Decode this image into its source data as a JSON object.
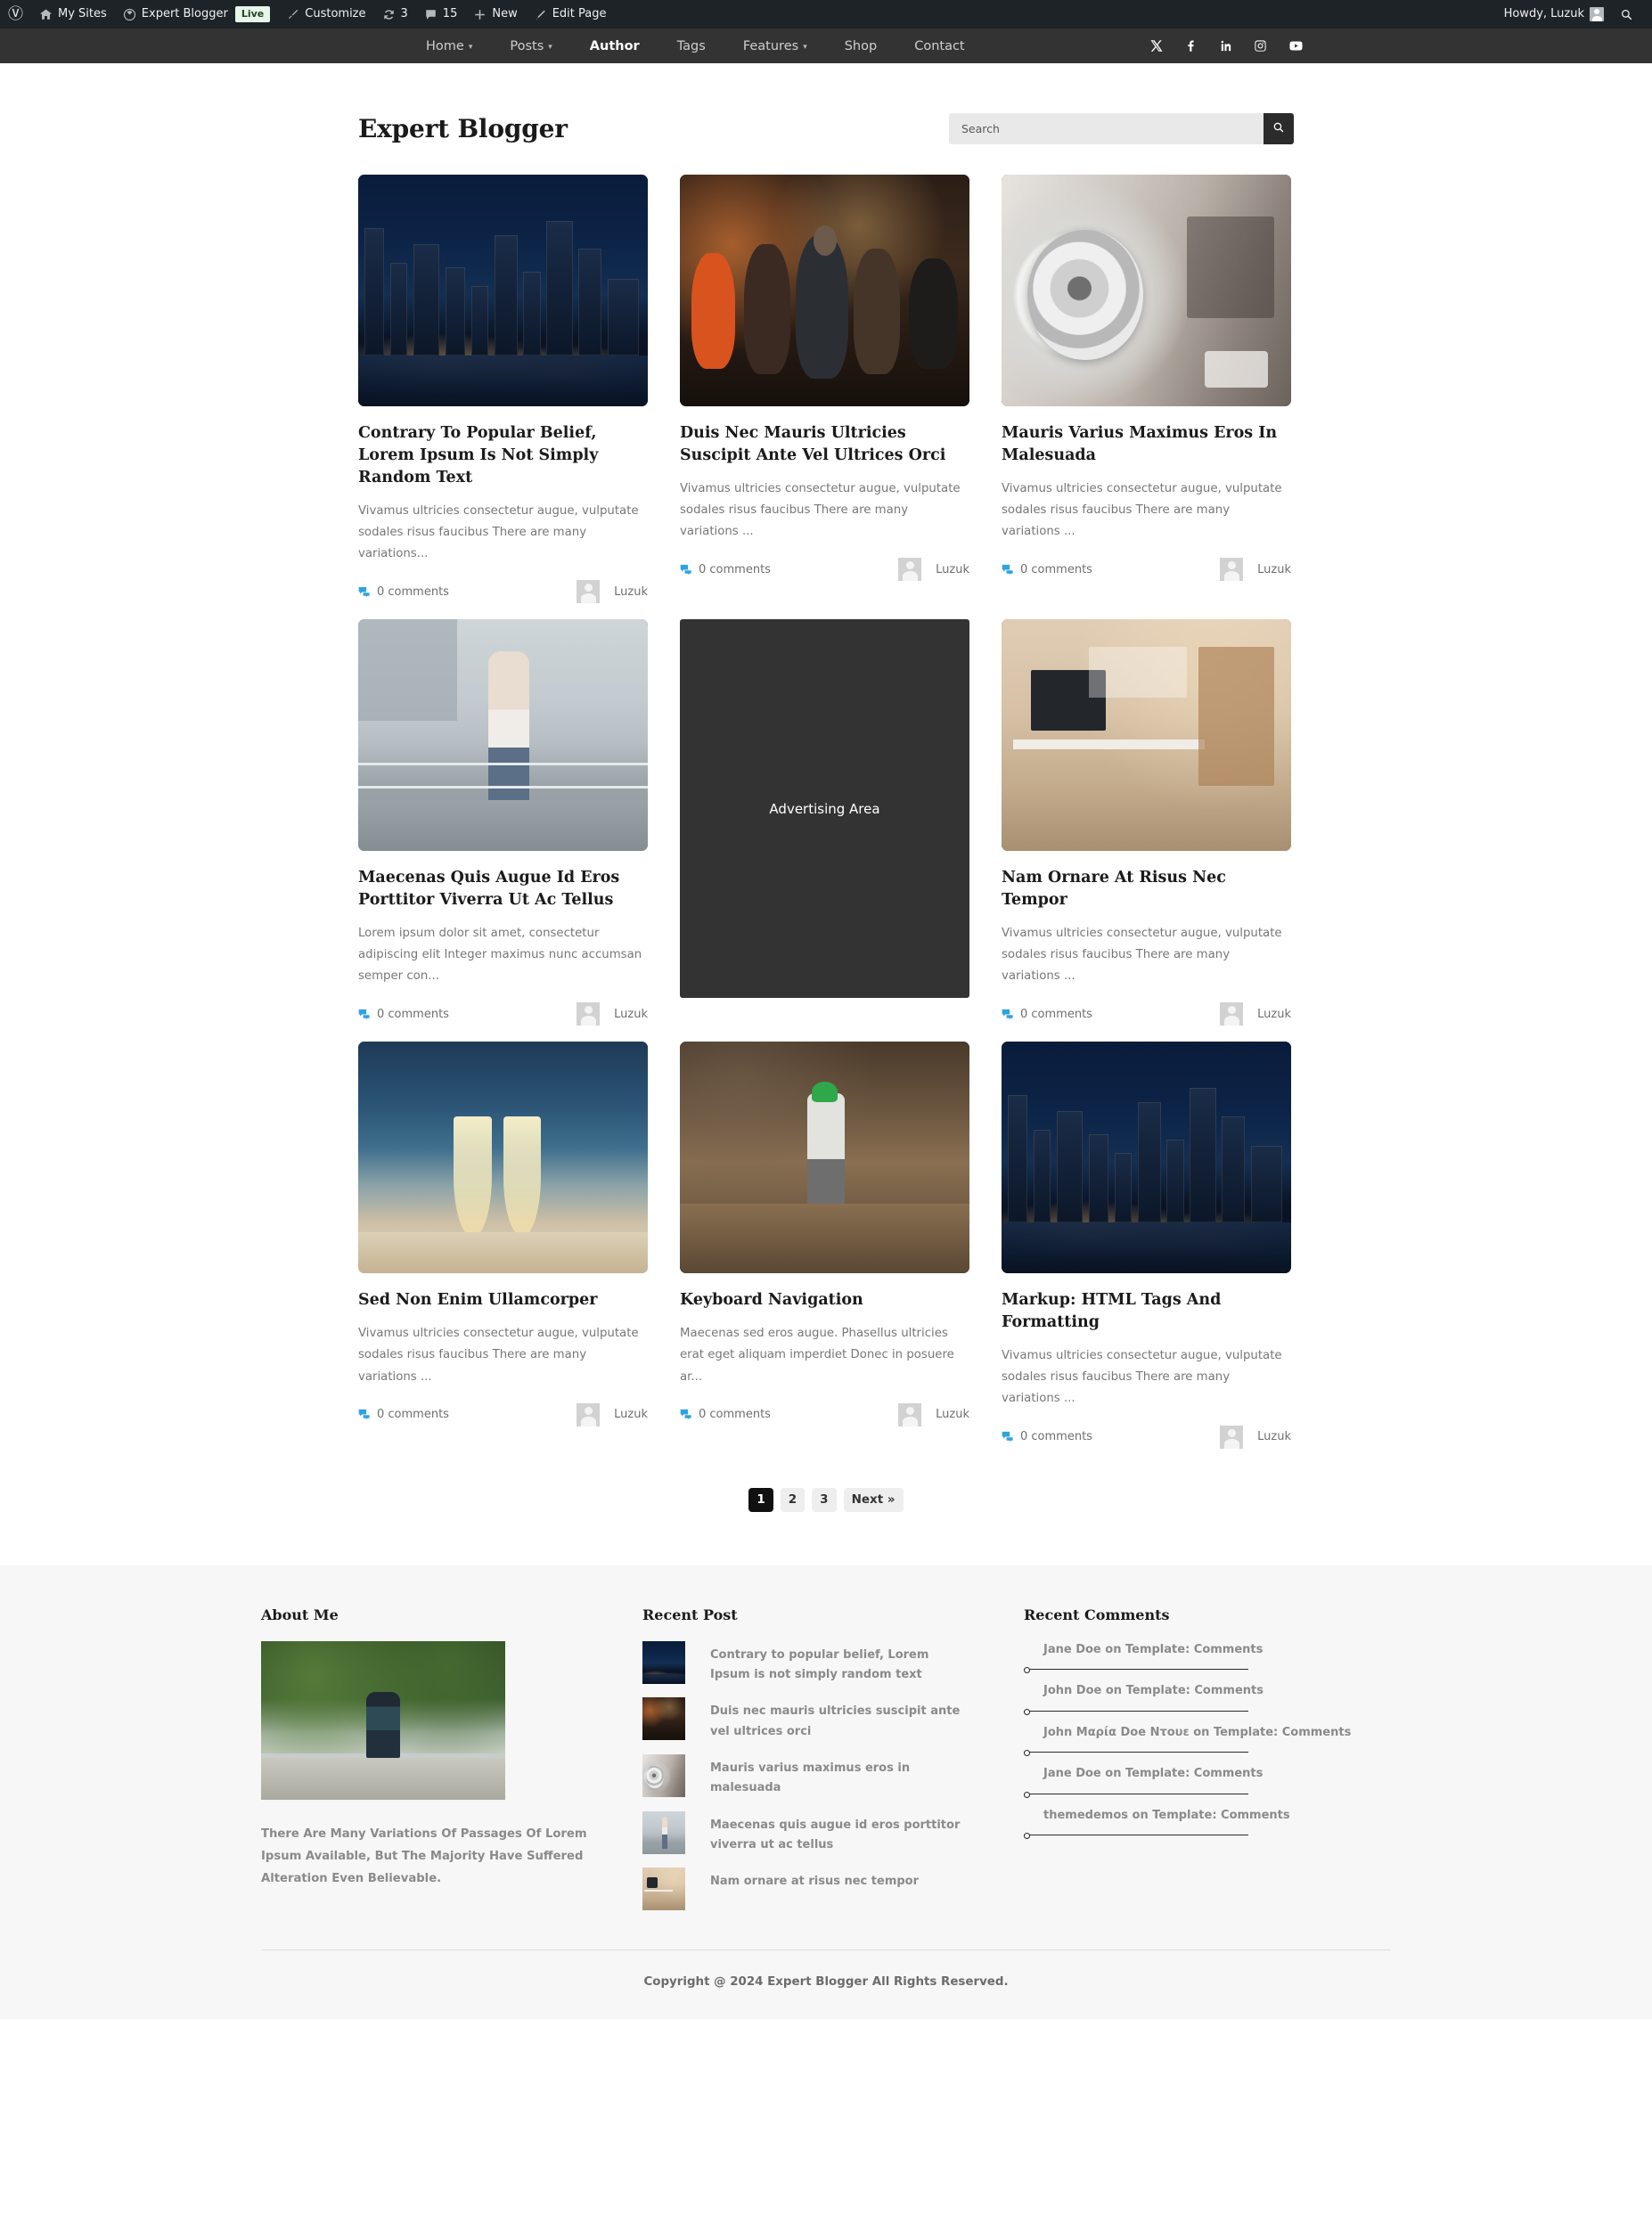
{
  "adminbar": {
    "wp_logo": "wordpress-logo-icon",
    "my_sites": "My Sites",
    "site_name": "Expert Blogger",
    "live_badge": "Live",
    "customize": "Customize",
    "updates_count": "3",
    "comments_count": "15",
    "new": "New",
    "edit_page": "Edit Page",
    "howdy": "Howdy, Luzuk",
    "search_label": "search-icon"
  },
  "nav": {
    "items": [
      {
        "label": "Home",
        "has_dropdown": true,
        "active": false
      },
      {
        "label": "Posts",
        "has_dropdown": true,
        "active": false
      },
      {
        "label": "Author",
        "has_dropdown": false,
        "active": true
      },
      {
        "label": "Tags",
        "has_dropdown": false,
        "active": false
      },
      {
        "label": "Features",
        "has_dropdown": true,
        "active": false
      },
      {
        "label": "Shop",
        "has_dropdown": false,
        "active": false
      },
      {
        "label": "Contact",
        "has_dropdown": false,
        "active": false
      }
    ],
    "socials": [
      "x-twitter-icon",
      "facebook-icon",
      "linkedin-icon",
      "instagram-icon",
      "youtube-icon"
    ]
  },
  "header": {
    "title": "Expert Blogger"
  },
  "search": {
    "value": "",
    "placeholder": "Search",
    "button_icon": "search-icon"
  },
  "posts": [
    {
      "title": "Contrary To Popular Belief, Lorem Ipsum Is Not Simply Random Text",
      "excerpt": "Vivamus ultricies consectetur augue, vulputate sodales risus faucibus There are many variations...",
      "comments": "0 comments",
      "author": "Luzuk",
      "image": "img-city"
    },
    {
      "title": "Duis Nec Mauris Ultricies Suscipit Ante Vel Ultrices Orci",
      "excerpt": "Vivamus ultricies consectetur augue, vulputate sodales risus faucibus There are many variations ...",
      "comments": "0 comments",
      "author": "Luzuk",
      "image": "img-street"
    },
    {
      "title": "Mauris Varius Maximus Eros In Malesuada",
      "excerpt": "Vivamus ultricies consectetur augue, vulputate sodales risus faucibus There are many variations ...",
      "comments": "0 comments",
      "author": "Luzuk",
      "image": "img-speaker"
    },
    {
      "title": "Maecenas Quis Augue Id Eros Porttitor Viverra Ut Ac Tellus",
      "excerpt": "Lorem ipsum dolor sit amet, consectetur adipiscing elit Integer maximus nunc accumsan semper con...",
      "comments": "0 comments",
      "author": "Luzuk",
      "image": "img-rail"
    },
    {
      "title": "Nam Ornare At Risus Nec Tempor",
      "excerpt": "Vivamus ultricies consectetur augue, vulputate sodales risus faucibus There are many variations ...",
      "comments": "0 comments",
      "author": "Luzuk",
      "image": "img-desk"
    },
    {
      "title": "Sed Non Enim Ullamcorper",
      "excerpt": "Vivamus ultricies consectetur augue, vulputate sodales risus faucibus There are many variations ...",
      "comments": "0 comments",
      "author": "Luzuk",
      "image": "img-glass"
    },
    {
      "title": "Keyboard Navigation",
      "excerpt": "Maecenas sed eros augue. Phasellus ultricies erat eget aliquam imperdiet Donec in posuere ar...",
      "comments": "0 comments",
      "author": "Luzuk",
      "image": "img-work"
    },
    {
      "title": "Markup: HTML Tags And Formatting",
      "excerpt": "Vivamus ultricies consectetur augue, vulputate sodales risus faucibus There are many variations ...",
      "comments": "0 comments",
      "author": "Luzuk",
      "image": "img-city"
    }
  ],
  "ad": {
    "label": "Advertising Area"
  },
  "pagination": {
    "pages": [
      "1",
      "2",
      "3"
    ],
    "current": "1",
    "next_label": "Next »"
  },
  "footer": {
    "about": {
      "title": "About Me",
      "text": "There Are Many Variations Of Passages Of Lorem Ipsum Available, But The Majority Have Suffered Alteration Even Believable."
    },
    "recent_posts": {
      "title": "Recent Post",
      "items": [
        {
          "title": "Contrary to popular belief, Lorem Ipsum is not simply random text",
          "image": "img-city"
        },
        {
          "title": "Duis nec mauris ultricies suscipit ante vel ultrices orci",
          "image": "img-street"
        },
        {
          "title": "Mauris varius maximus eros in malesuada",
          "image": "img-speaker"
        },
        {
          "title": "Maecenas quis augue id eros porttitor viverra ut ac tellus",
          "image": "img-rail"
        },
        {
          "title": "Nam ornare at risus nec tempor",
          "image": "img-desk"
        }
      ]
    },
    "recent_comments": {
      "title": "Recent Comments",
      "items": [
        {
          "author": "Jane Doe",
          "on": "on",
          "post": "Template: Comments"
        },
        {
          "author": "John Doe",
          "on": "on",
          "post": "Template: Comments"
        },
        {
          "author": "John Μαρία Doe Ντουε",
          "on": "on",
          "post": "Template: Comments"
        },
        {
          "author": "Jane Doe",
          "on": "on",
          "post": "Template: Comments"
        },
        {
          "author": "themedemos",
          "on": "on",
          "post": "Template: Comments"
        }
      ]
    },
    "copyright": "Copyright @ 2024 Expert Blogger All Rights Reserved."
  },
  "colors": {
    "adminbar_bg": "#1d2327",
    "nav_bg": "#333333",
    "accent_comment": "#2ea3e0",
    "footer_bg": "#f7f7f7",
    "page_active": "#111111"
  }
}
